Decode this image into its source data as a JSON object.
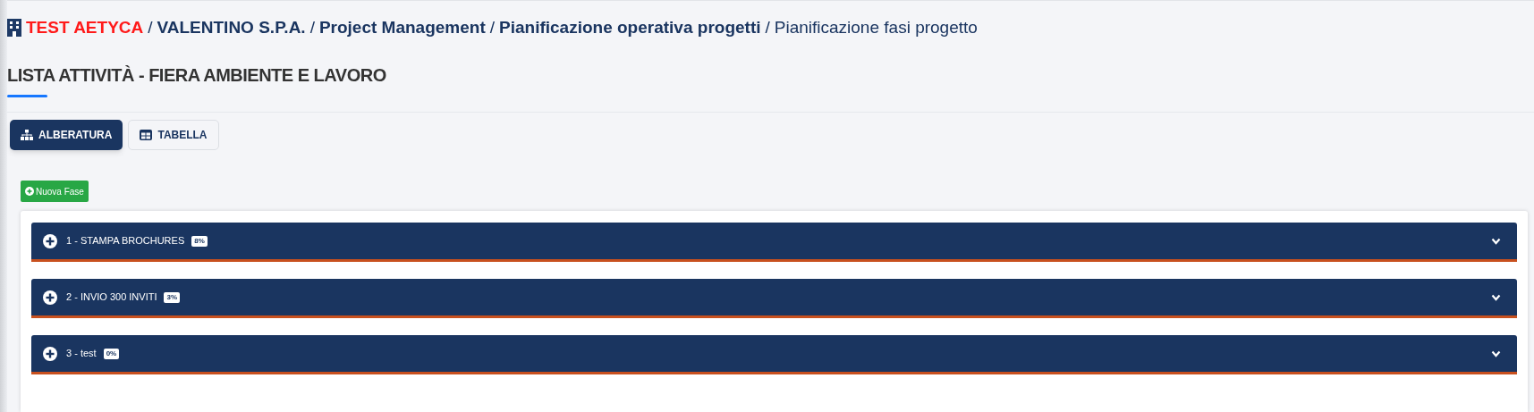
{
  "breadcrumb": [
    {
      "label": "TEST AETYCA",
      "kind": "company"
    },
    {
      "label": "VALENTINO S.P.A.",
      "kind": "link"
    },
    {
      "label": "Project Management",
      "kind": "link"
    },
    {
      "label": "Pianificazione operativa progetti",
      "kind": "link"
    },
    {
      "label": "Pianificazione fasi progetto",
      "kind": "current"
    }
  ],
  "separator": "/",
  "page_title": "LISTA ATTIVITÀ - FIERA AMBIENTE E LAVORO",
  "tabs": [
    {
      "label": "ALBERATURA",
      "kind": "tree",
      "selected": true
    },
    {
      "label": "TABELLA",
      "kind": "table",
      "selected": false
    }
  ],
  "new_phase_button": "Nuova Fase",
  "phases": [
    {
      "title": "1 - STAMPA BROCHURES",
      "progress": "8%",
      "expanded": false
    },
    {
      "title": "2 - INVIO 300 INVITI",
      "progress": "3%",
      "expanded": false
    },
    {
      "title": "3 - test",
      "progress": "0%",
      "expanded": false
    }
  ]
}
